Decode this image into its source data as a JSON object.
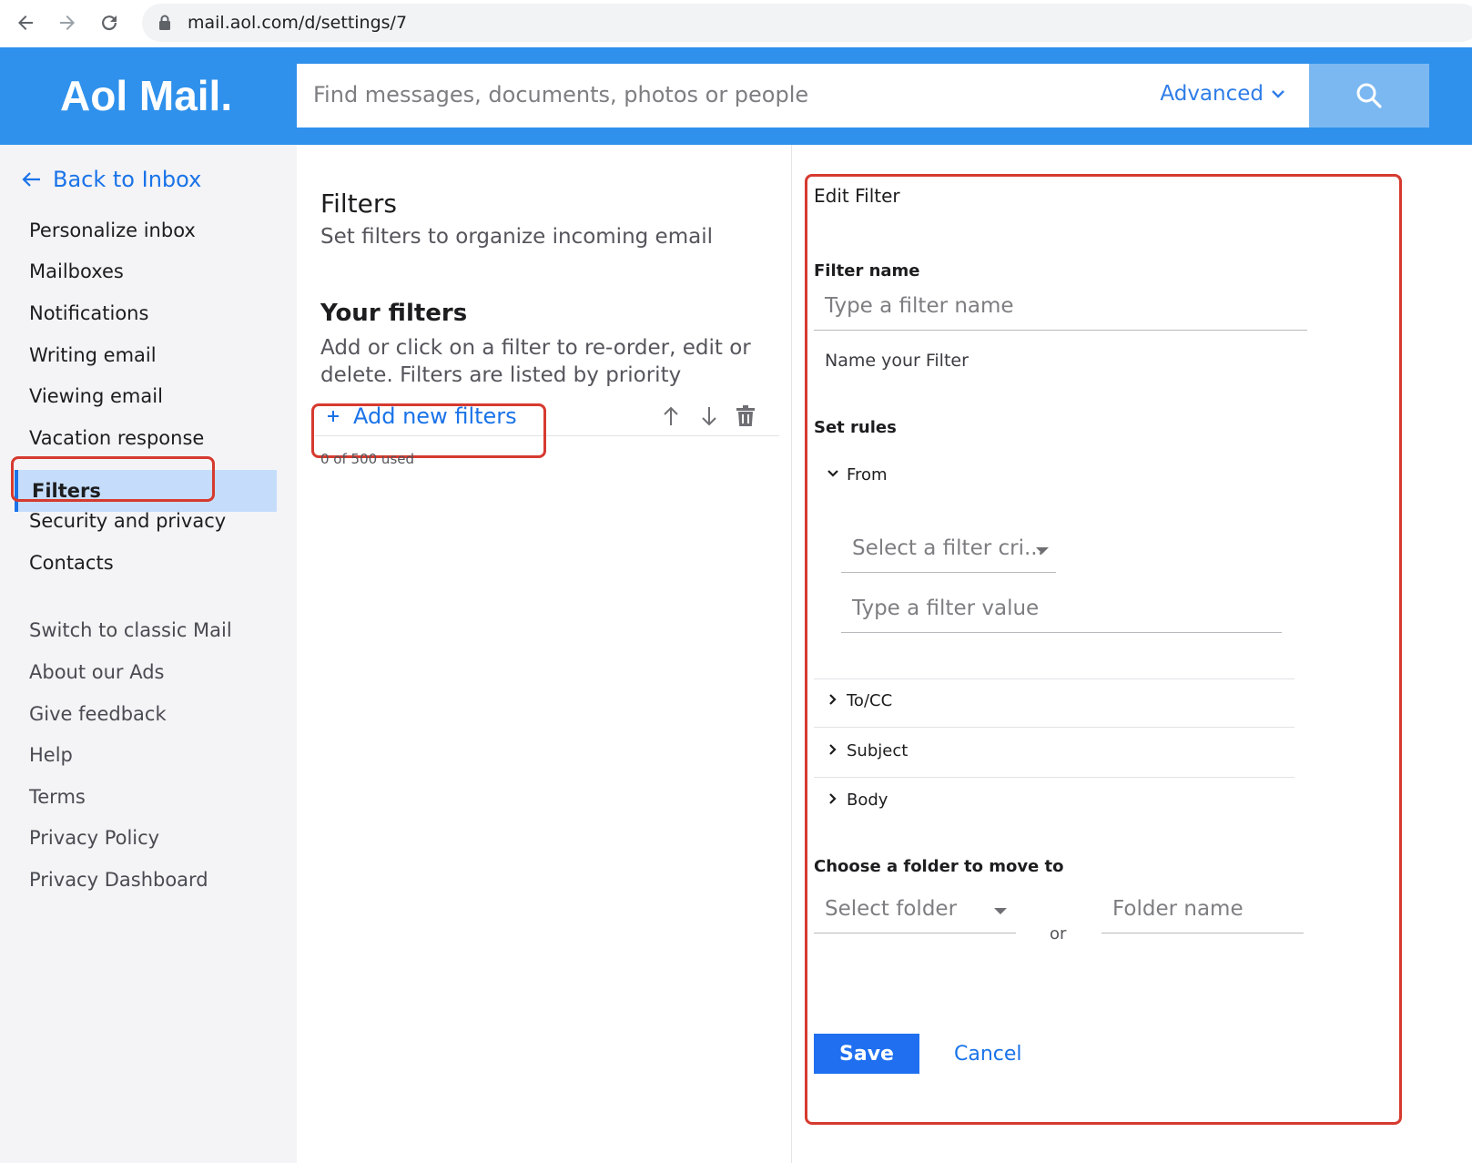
{
  "browser": {
    "url": "mail.aol.com/d/settings/7",
    "back_icon": "back-arrow-icon",
    "forward_icon": "forward-arrow-icon",
    "reload_icon": "reload-icon",
    "lock_icon": "lock-icon"
  },
  "header": {
    "logo": "Aol Mail.",
    "search_placeholder": "Find messages, documents, photos or people",
    "advanced_label": "Advanced",
    "search_icon": "search-icon",
    "brand_color": "#2f91ec"
  },
  "sidebar": {
    "back_label": "Back to Inbox",
    "items": [
      {
        "label": "Personalize inbox"
      },
      {
        "label": "Mailboxes"
      },
      {
        "label": "Notifications"
      },
      {
        "label": "Writing email"
      },
      {
        "label": "Viewing email"
      },
      {
        "label": "Vacation response"
      },
      {
        "label": "Filters",
        "active": true
      },
      {
        "label": "Security and privacy"
      },
      {
        "label": "Contacts"
      }
    ],
    "footer_items": [
      {
        "label": "Switch to classic Mail"
      },
      {
        "label": "About our Ads"
      },
      {
        "label": "Give feedback"
      },
      {
        "label": "Help"
      },
      {
        "label": "Terms"
      },
      {
        "label": "Privacy Policy"
      },
      {
        "label": "Privacy Dashboard"
      }
    ]
  },
  "filters_panel": {
    "title": "Filters",
    "subtitle": "Set filters to organize incoming email",
    "your_filters_title": "Your filters",
    "your_filters_desc": "Add or click on a filter to re-order, edit or delete. Filters are listed by priority",
    "add_label": "Add new filters",
    "used_text": "0 of 500 used"
  },
  "edit_filter": {
    "title": "Edit Filter",
    "filter_name_label": "Filter name",
    "filter_name_placeholder": "Type a filter name",
    "filter_name_hint": "Name your Filter",
    "set_rules_label": "Set rules",
    "rules": [
      {
        "label": "From",
        "expanded": true
      },
      {
        "label": "To/CC",
        "expanded": false
      },
      {
        "label": "Subject",
        "expanded": false
      },
      {
        "label": "Body",
        "expanded": false
      }
    ],
    "criteria_placeholder": "Select a filter cri...",
    "value_placeholder": "Type a filter value",
    "folder_label": "Choose a folder to move to",
    "select_folder_placeholder": "Select folder",
    "or_text": "or",
    "folder_name_placeholder": "Folder name",
    "save_label": "Save",
    "cancel_label": "Cancel"
  },
  "highlight_color": "#d63a2f",
  "accent_color": "#1a73e8"
}
